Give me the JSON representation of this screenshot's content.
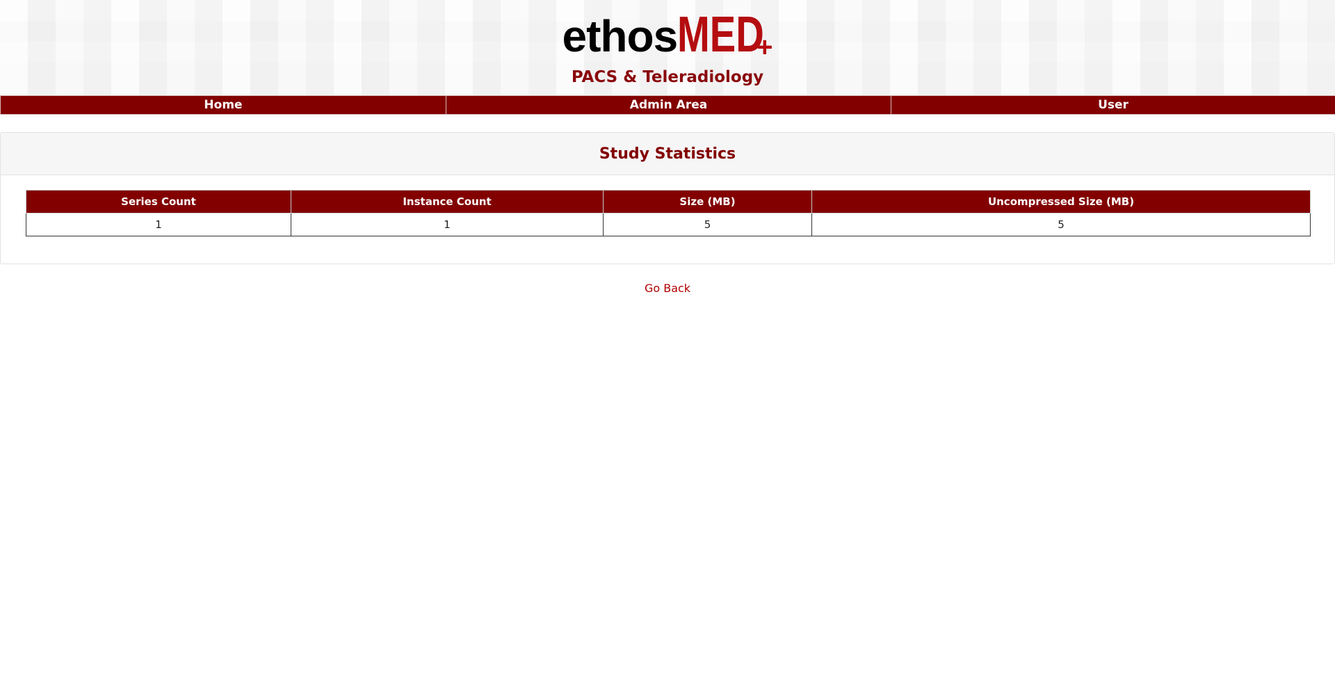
{
  "brand": {
    "logo_ethos": "ethos",
    "logo_med": "MED",
    "logo_plus": "+",
    "subtitle": "PACS & Teleradiology",
    "accent_color": "#820000",
    "logo_red": "#b50d10"
  },
  "nav": {
    "items": [
      {
        "label": "Home"
      },
      {
        "label": "Admin Area"
      },
      {
        "label": "User"
      }
    ]
  },
  "panel": {
    "title": "Study Statistics"
  },
  "table": {
    "headers": [
      "Series Count",
      "Instance Count",
      "Size (MB)",
      "Uncompressed Size (MB)"
    ],
    "rows": [
      [
        "1",
        "1",
        "5",
        "5"
      ]
    ]
  },
  "footer": {
    "go_back_label": "Go Back"
  }
}
